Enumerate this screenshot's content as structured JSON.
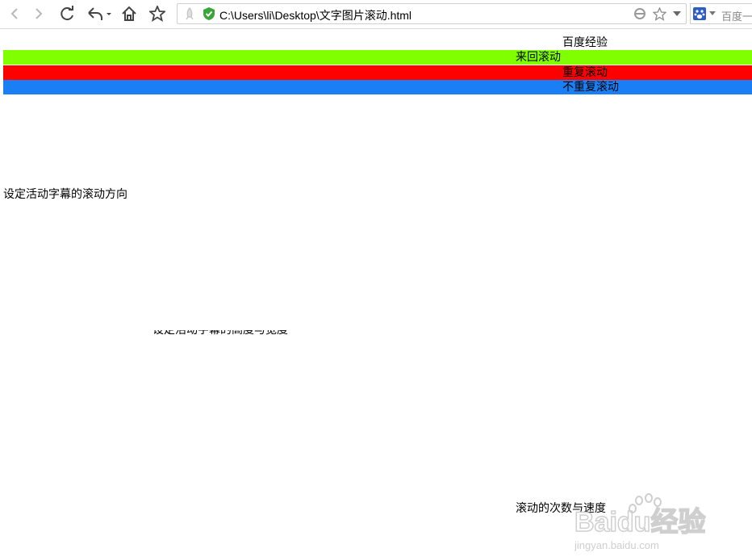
{
  "browser": {
    "address": "C:\\Users\\li\\Desktop\\文字图片滚动.html",
    "search_placeholder": "百度一"
  },
  "page": {
    "heading_text": "百度经验",
    "marquees": [
      {
        "label": "来回滚动",
        "color": "#80ff00"
      },
      {
        "label": "重复滚动",
        "color": "#ff0000"
      },
      {
        "label": "不重复滚动",
        "color": "#1a7ff5"
      }
    ],
    "direction_text": "设定活动字幕的滚动方向",
    "size_text": "设定活动字幕的高度与宽度",
    "speed_text": "滚动的次数与速度"
  },
  "watermark": {
    "logo_text": "Baidu经验",
    "url": "jingyan.baidu.com"
  }
}
